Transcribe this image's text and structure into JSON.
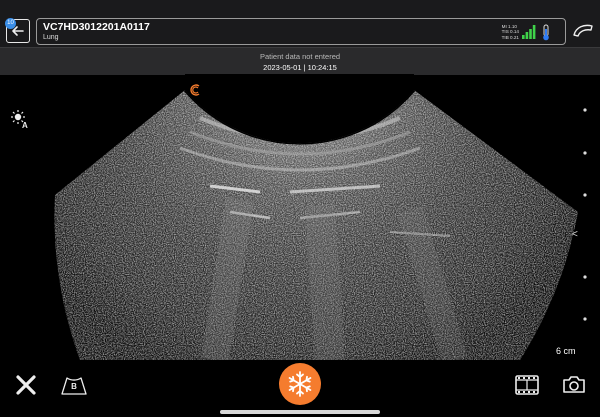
{
  "header": {
    "badge_count": "10",
    "probe_id": "VC7HD3012201A0117",
    "preset": "Lung",
    "indices": {
      "mi": "MI 1.10",
      "tis": "TIS 0.14",
      "tib": "TIB 0.21"
    }
  },
  "info": {
    "patient_status": "Patient data not entered",
    "datetime": "2023-05-01 | 10:24:15"
  },
  "image": {
    "depth": "6 cm",
    "focus_marker": "<"
  },
  "colors": {
    "accent_orange": "#f57c2e",
    "battery_green": "#3fd34a",
    "thermo_blue": "#2f7bf2"
  },
  "icons": {
    "back": "back-arrow-icon",
    "probe": "probe-icon",
    "mode": "b-mode-icon",
    "freeze": "snowflake-icon",
    "cine": "film-icon",
    "capture": "camera-icon",
    "close": "close-icon",
    "auto_gain": "auto-brightness-icon"
  },
  "footer": {
    "mode_label": "B"
  }
}
